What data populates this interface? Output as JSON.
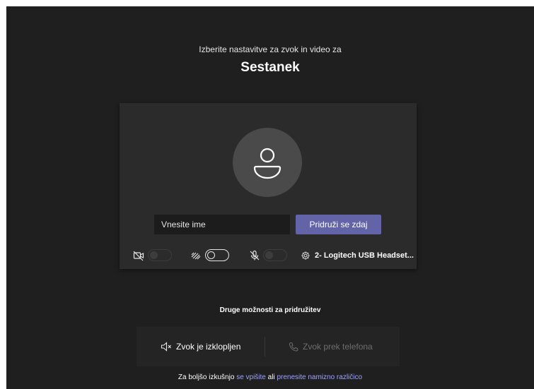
{
  "prejoin": {
    "subtitle": "Izberite nastavitve za zvok in video za",
    "meeting_title": "Sestanek",
    "name_placeholder": "Vnesite ime",
    "join_button": "Pridruži se zdaj",
    "device_label": "2- Logitech USB Headset..."
  },
  "controls": {
    "camera_icon": "camera-off-icon",
    "blur_icon": "background-blur-icon",
    "mic_icon": "mic-off-icon",
    "settings_icon": "gear-icon"
  },
  "other_options": {
    "heading": "Druge možnosti za pridružitev",
    "audio_off_label": "Zvok je izklopljen",
    "phone_audio_label": "Zvok prek telefona"
  },
  "footer": {
    "prefix": "Za boljšo izkušnjo ",
    "signin_link": "se vpišite",
    "middle": " ali ",
    "download_link": "prenesite namizno različico"
  },
  "colors": {
    "accent": "#6264a7",
    "background": "#1f1f1f",
    "card": "#2b2b2b",
    "link": "#9ea2ff"
  }
}
